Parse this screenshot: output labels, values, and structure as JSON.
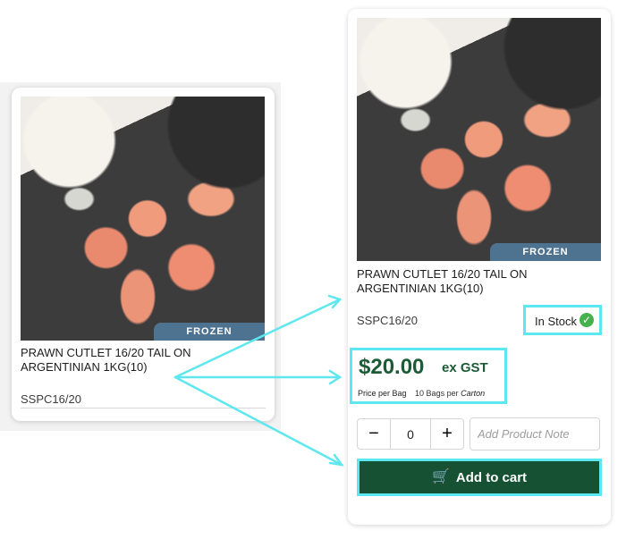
{
  "product": {
    "badge": "FROZEN",
    "title": "PRAWN CUTLET 16/20 TAIL ON ARGENTINIAN 1KG(10)",
    "sku": "SSPC16/20"
  },
  "stock": {
    "label": "In Stock"
  },
  "pricing": {
    "price": "$20.00",
    "tax_label": "ex GST",
    "unit_label": "Price per Bag",
    "bags_text": "10 Bags per",
    "carton_text": "Carton"
  },
  "quantity": {
    "value": "0",
    "decrement_label": "−",
    "increment_label": "+"
  },
  "note": {
    "placeholder": "Add Product Note"
  },
  "cart": {
    "label": "Add to cart"
  },
  "colors": {
    "accent_cyan": "#5ee7ef",
    "button_green": "#175133",
    "price_green": "#1d5b36",
    "badge_blue": "#4e7390",
    "stock_green": "#45b04c"
  }
}
